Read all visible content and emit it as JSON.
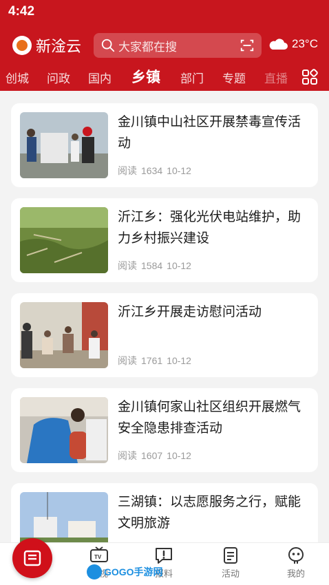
{
  "status": {
    "time": "4:42"
  },
  "header": {
    "brand_name": "新淦云",
    "search_placeholder": "大家都在搜",
    "temperature": "23°C"
  },
  "tabs": [
    {
      "label": "创城"
    },
    {
      "label": "问政"
    },
    {
      "label": "国内"
    },
    {
      "label": "乡镇",
      "active": true
    },
    {
      "label": "部门"
    },
    {
      "label": "专题"
    },
    {
      "label": "直播"
    }
  ],
  "articles": [
    {
      "title": "金川镇中山社区开展禁毒宣传活动",
      "read_label": "阅读",
      "reads": "1634",
      "date": "10-12"
    },
    {
      "title": "沂江乡：强化光伏电站维护，助力乡村振兴建设",
      "read_label": "阅读",
      "reads": "1584",
      "date": "10-12"
    },
    {
      "title": "沂江乡开展走访慰问活动",
      "read_label": "阅读",
      "reads": "1761",
      "date": "10-12"
    },
    {
      "title": "金川镇何家山社区组织开展燃气安全隐患排查活动",
      "read_label": "阅读",
      "reads": "1607",
      "date": "10-12"
    },
    {
      "title": "三湖镇：以志愿服务之行，赋能文明旅游",
      "read_label": "",
      "reads": "",
      "date": ""
    }
  ],
  "bottom_nav": [
    {
      "label": "",
      "icon": "news-icon"
    },
    {
      "label": "电视",
      "icon": "tv-icon"
    },
    {
      "label": "报料",
      "icon": "report-icon"
    },
    {
      "label": "活动",
      "icon": "activity-icon"
    },
    {
      "label": "我的",
      "icon": "profile-icon"
    }
  ],
  "watermark": {
    "text": "GOGO手游网"
  },
  "colors": {
    "brand_red": "#c8161e",
    "accent_orange": "#e8701a"
  }
}
